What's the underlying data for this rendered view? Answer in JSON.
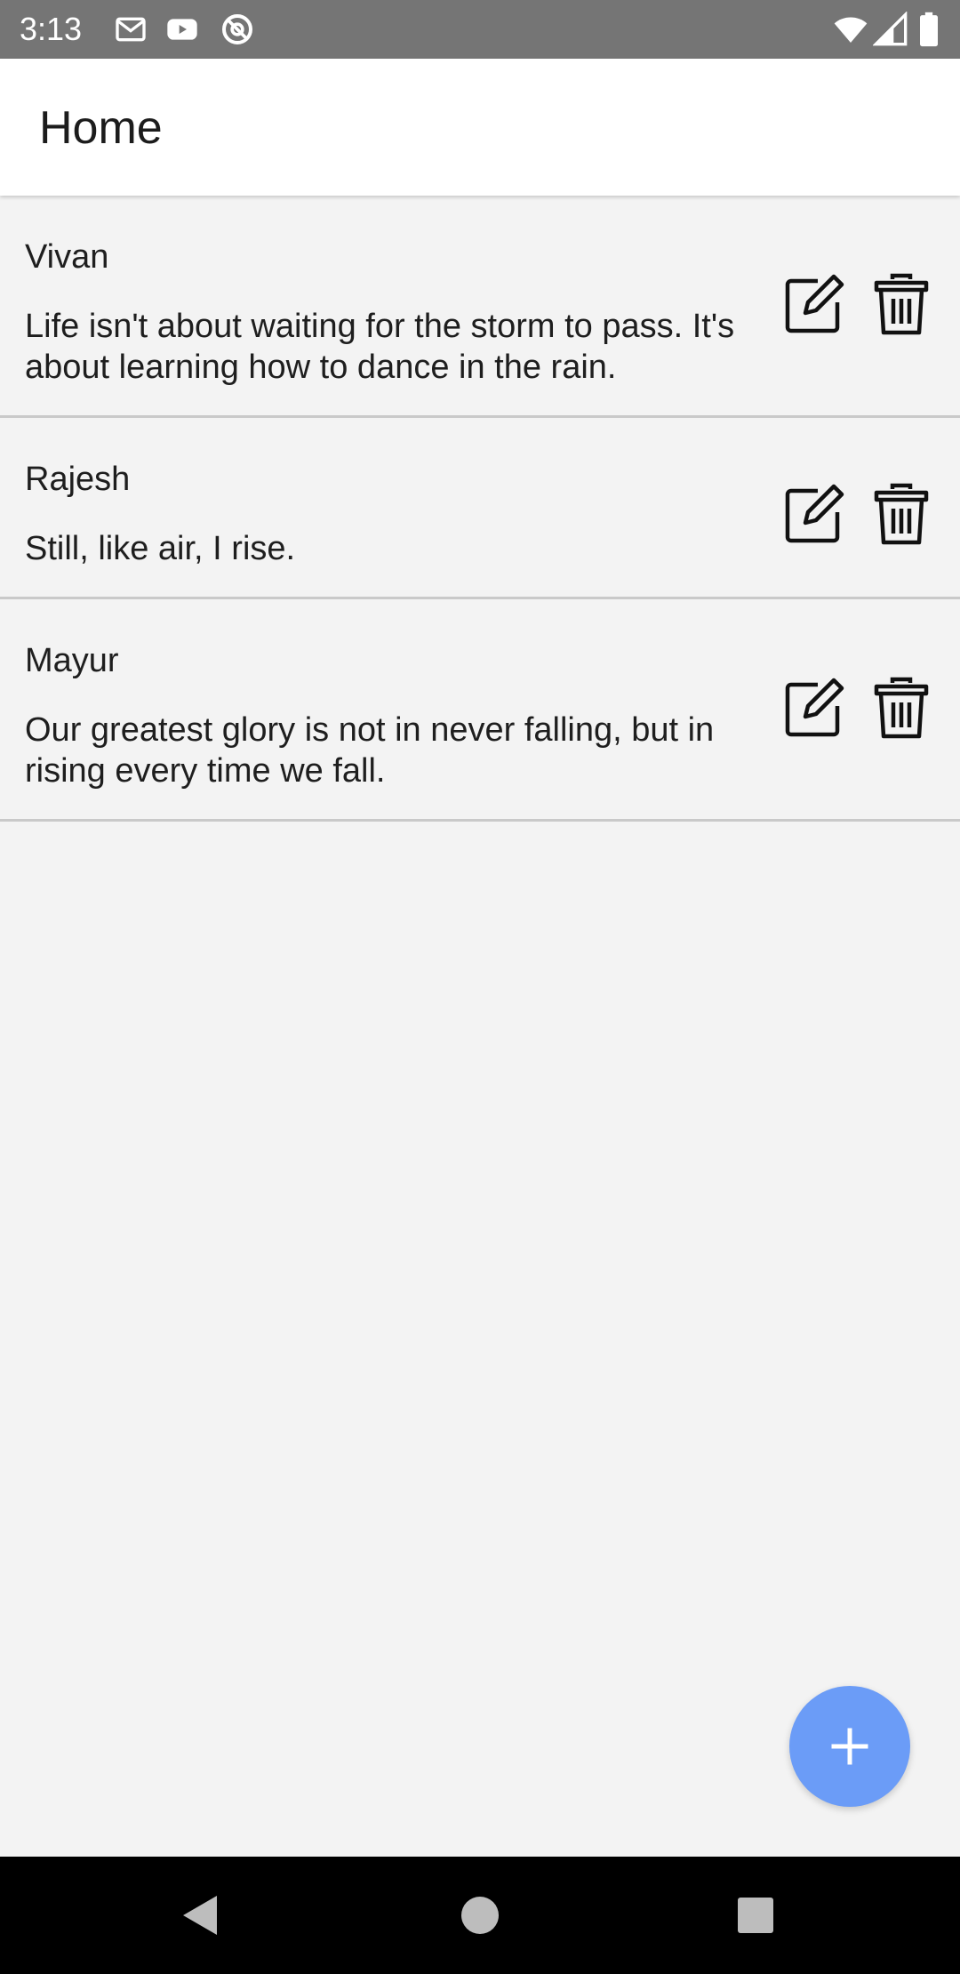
{
  "status_bar": {
    "time": "3:13",
    "left_icons": [
      "gmail-icon",
      "youtube-icon",
      "at-sign-icon"
    ],
    "right_icons": [
      "wifi-icon",
      "cell-signal-icon",
      "battery-icon"
    ]
  },
  "app_bar": {
    "title": "Home"
  },
  "notes": [
    {
      "author": "Vivan",
      "quote": "Life isn't about waiting for the storm to pass. It's about learning how to dance in the rain."
    },
    {
      "author": "Rajesh",
      "quote": "Still, like air, I rise."
    },
    {
      "author": "Mayur",
      "quote": "Our greatest glory is not in never falling, but in rising every time we fall."
    }
  ],
  "item_actions": [
    "edit-icon",
    "trash-icon"
  ],
  "fab": {
    "icon": "plus-icon",
    "color": "#6b9cf7"
  },
  "nav_bar": {
    "buttons": [
      "back-icon",
      "home-icon",
      "recents-icon"
    ]
  },
  "colors": {
    "status_bar": "#757575",
    "app_bar": "#ffffff",
    "background": "#f3f3f3",
    "divider": "#c9c9c9",
    "nav_bar": "#000000"
  }
}
